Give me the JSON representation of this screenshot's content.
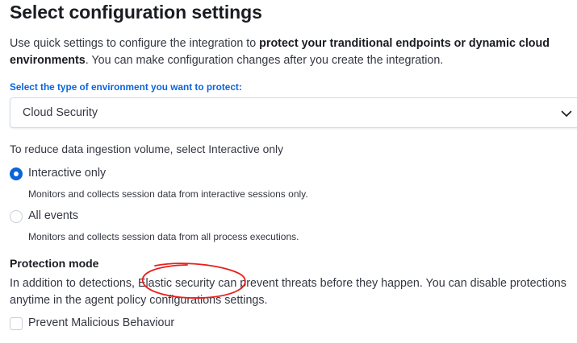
{
  "header": {
    "title": "Select configuration settings"
  },
  "intro": {
    "text_before": "Use quick settings to configure the integration to ",
    "bold": "protect your tranditional endpoints or dynamic cloud environments",
    "text_after": ". You can make configuration changes after you create the integration."
  },
  "environment": {
    "label": "Select the type of environment you want to protect:",
    "selected_value": "Cloud Security"
  },
  "ingestion": {
    "hint": "To reduce data ingestion volume, select Interactive only",
    "options": [
      {
        "label": "Interactive only",
        "description": "Monitors and collects session data from interactive sessions only.",
        "checked": true
      },
      {
        "label": "All events",
        "description": "Monitors and collects session data from all process executions.",
        "checked": false
      }
    ]
  },
  "protection": {
    "title": "Protection mode",
    "text": "In addition to detections, Elastic security can prevent threats before they happen. You can disable protections anytime in the agent policy configurations settings.",
    "checkbox_label": "Prevent Malicious Behaviour",
    "checkbox_checked": false
  },
  "colors": {
    "accent": "#0b64dd",
    "annotation_circle": "#e8201c"
  }
}
